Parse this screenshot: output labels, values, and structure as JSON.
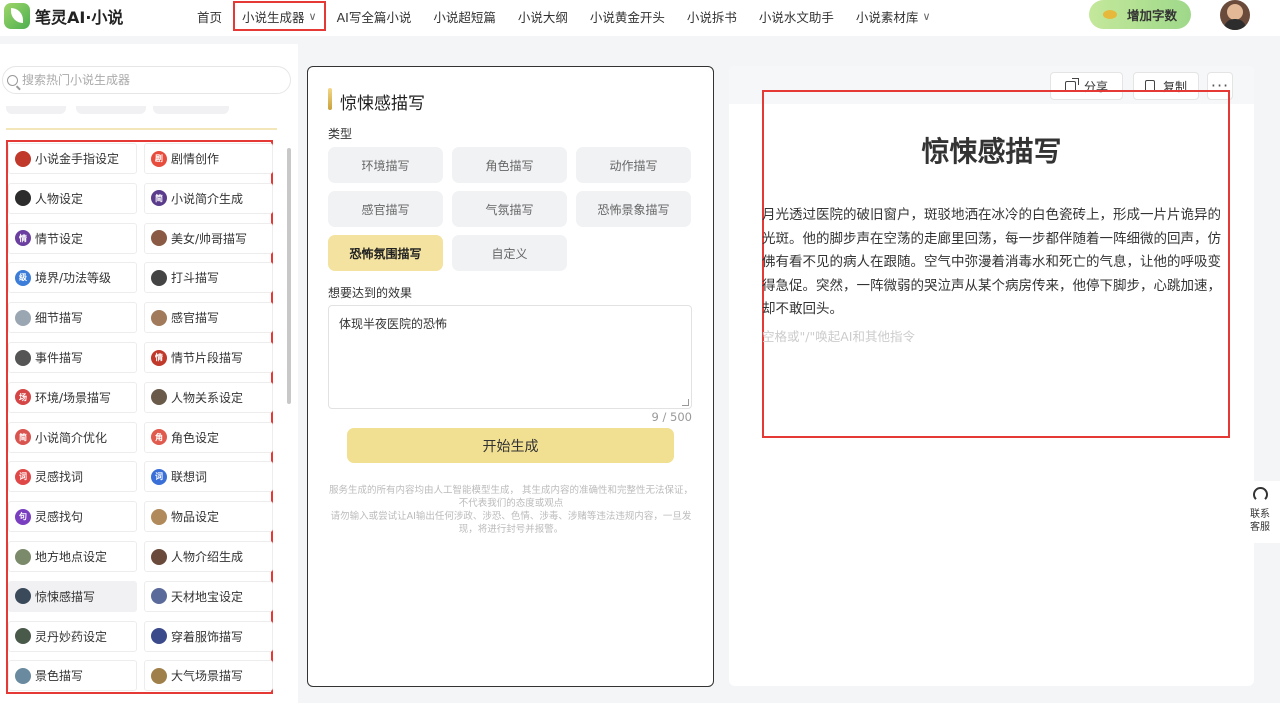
{
  "header": {
    "logo_text": "笔灵AI·小说",
    "nav": [
      {
        "label": "首页"
      },
      {
        "label": "小说生成器",
        "has_dropdown": true,
        "active": true
      },
      {
        "label": "AI写全篇小说"
      },
      {
        "label": "小说超短篇"
      },
      {
        "label": "小说大纲"
      },
      {
        "label": "小说黄金开头"
      },
      {
        "label": "小说拆书"
      },
      {
        "label": "小说水文助手"
      },
      {
        "label": "小说素材库",
        "has_dropdown": true
      }
    ],
    "add_words_label": "增加字数",
    "chevron": "∨"
  },
  "sidebar": {
    "search_placeholder": "搜索热门小说生成器",
    "tools": [
      {
        "label": "小说金手指设定",
        "icon": "golden-finger-icon",
        "color": "#c0392b"
      },
      {
        "label": "剧情创作",
        "icon": "plot-icon",
        "color": "#e74c3c",
        "glyph": "剧"
      },
      {
        "label": "人物设定",
        "icon": "character-icon",
        "color": "#2c2c2c"
      },
      {
        "label": "小说简介生成",
        "icon": "intro-icon",
        "color": "#5b3b8c",
        "glyph": "简"
      },
      {
        "label": "情节设定",
        "icon": "plot-setting-icon",
        "color": "#6b3fa0",
        "glyph": "情"
      },
      {
        "label": "美女/帅哥描写",
        "icon": "beauty-icon",
        "color": "#8a5a44"
      },
      {
        "label": "境界/功法等级",
        "icon": "realm-icon",
        "color": "#3b7dd8",
        "glyph": "级"
      },
      {
        "label": "打斗描写",
        "icon": "fight-icon",
        "color": "#444444"
      },
      {
        "label": "细节描写",
        "icon": "magnifier-icon",
        "color": "#9aa6b2"
      },
      {
        "label": "感官描写",
        "icon": "senses-icon",
        "color": "#a07a5a"
      },
      {
        "label": "事件描写",
        "icon": "event-icon",
        "color": "#555555"
      },
      {
        "label": "情节片段描写",
        "icon": "fragment-icon",
        "color": "#c0392b",
        "glyph": "情"
      },
      {
        "label": "环境/场景描写",
        "icon": "scene-icon",
        "color": "#d64545",
        "glyph": "场"
      },
      {
        "label": "人物关系设定",
        "icon": "relation-icon",
        "color": "#6a5a4a"
      },
      {
        "label": "小说简介优化",
        "icon": "optimize-icon",
        "color": "#d9534f",
        "glyph": "简"
      },
      {
        "label": "角色设定",
        "icon": "role-icon",
        "color": "#e05a4e",
        "glyph": "角"
      },
      {
        "label": "灵感找词",
        "icon": "word-icon",
        "color": "#e04848",
        "glyph": "词"
      },
      {
        "label": "联想词",
        "icon": "association-icon",
        "color": "#3a6fd8",
        "glyph": "词"
      },
      {
        "label": "灵感找句",
        "icon": "sentence-icon",
        "color": "#7a3fc0",
        "glyph": "句"
      },
      {
        "label": "物品设定",
        "icon": "item-icon",
        "color": "#b08a5a"
      },
      {
        "label": "地方地点设定",
        "icon": "place-icon",
        "color": "#7a8a6a"
      },
      {
        "label": "人物介绍生成",
        "icon": "profile-icon",
        "color": "#6a4a3a"
      },
      {
        "label": "惊悚感描写",
        "icon": "thriller-icon",
        "color": "#3a4a5a",
        "active": true
      },
      {
        "label": "天材地宝设定",
        "icon": "treasure-icon",
        "color": "#5a6a9a"
      },
      {
        "label": "灵丹妙药设定",
        "icon": "elixir-icon",
        "color": "#4a5a4a"
      },
      {
        "label": "穿着服饰描写",
        "icon": "clothing-icon",
        "color": "#3a4a8a"
      },
      {
        "label": "景色描写",
        "icon": "landscape-icon",
        "color": "#6a8aa0"
      },
      {
        "label": "大气场景描写",
        "icon": "grand-scene-icon",
        "color": "#a0804a"
      }
    ]
  },
  "form": {
    "title": "惊悚感描写",
    "type_label": "类型",
    "types": [
      {
        "label": "环境描写"
      },
      {
        "label": "角色描写"
      },
      {
        "label": "动作描写"
      },
      {
        "label": "感官描写"
      },
      {
        "label": "气氛描写"
      },
      {
        "label": "恐怖景象描写"
      },
      {
        "label": "恐怖氛围描写",
        "selected": true
      },
      {
        "label": "自定义"
      }
    ],
    "effect_label": "想要达到的效果",
    "effect_value": "体现半夜医院的恐怖",
    "counter": "9 / 500",
    "generate_label": "开始生成",
    "disclaimer_1": "服务生成的所有内容均由人工智能模型生成， 其生成内容的准确性和完整性无法保证， 不代表我们的态度或观点",
    "disclaimer_2": "请勿输入或尝试让AI输出任何涉政、涉恐、色情、涉毒、涉赌等违法违规内容，一旦发现，将进行封号并报警。"
  },
  "result": {
    "share_label": "分享",
    "copy_label": "复制",
    "more_label": "···",
    "title": "惊悚感描写",
    "body": "月光透过医院的破旧窗户，斑驳地洒在冰冷的白色瓷砖上，形成一片片诡异的光斑。他的脚步声在空荡的走廊里回荡，每一步都伴随着一阵细微的回声，仿佛有看不见的病人在跟随。空气中弥漫着消毒水和死亡的气息，让他的呼吸变得急促。突然，一阵微弱的哭泣声从某个病房传来，他停下脚步，心跳加速，却不敢回头。",
    "hint": "空格或\"/\"唤起AI和其他指令"
  },
  "rail": {
    "support_label": "联系客服"
  }
}
